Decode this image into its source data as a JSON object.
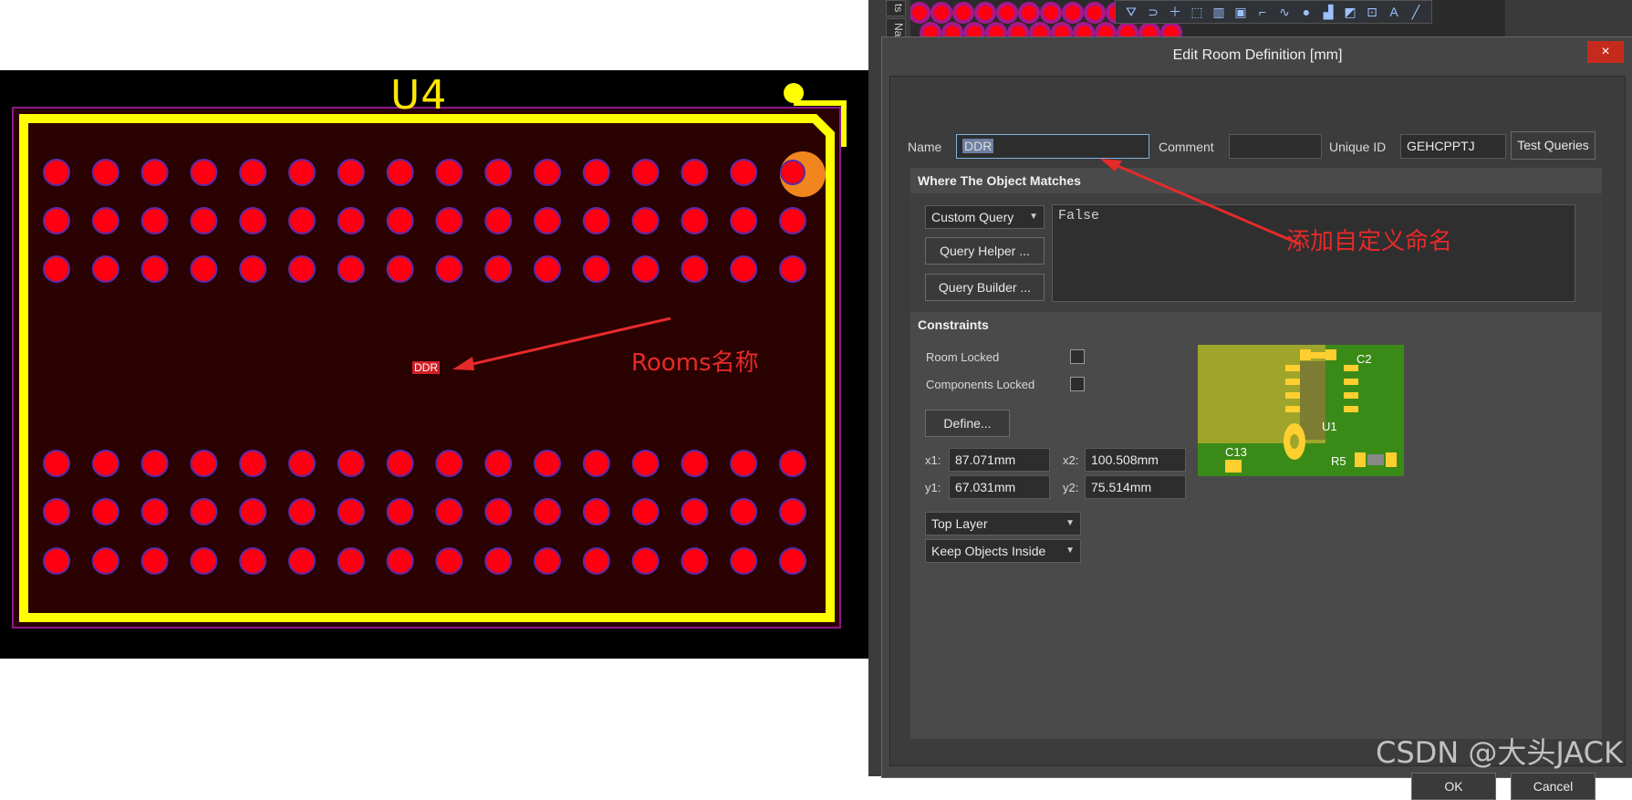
{
  "pcb": {
    "component_designator": "U4",
    "room_label": "DDR",
    "annotation": "Rooms名称",
    "colors": {
      "board": "#2a0000",
      "pad": "#ff0012",
      "silk": "#ffff00",
      "outline": "#8b1a8b"
    }
  },
  "dialog": {
    "title": "Edit Room Definition [mm]",
    "close_label": "×",
    "name_label": "Name",
    "name_value": "DDR",
    "comment_label": "Comment",
    "comment_value": "",
    "unique_id_label": "Unique ID",
    "unique_id_value": "GEHCPPTJ",
    "test_queries_label": "Test Queries",
    "where_section_title": "Where The Object Matches",
    "query_type": "Custom Query",
    "query_helper_label": "Query Helper ...",
    "query_builder_label": "Query Builder ...",
    "query_text": "False",
    "constraints_title": "Constraints",
    "room_locked_label": "Room Locked",
    "components_locked_label": "Components Locked",
    "define_label": "Define...",
    "x1_label": "x1:",
    "x1_value": "87.071mm",
    "x2_label": "x2:",
    "x2_value": "100.508mm",
    "y1_label": "y1:",
    "y1_value": "67.031mm",
    "y2_label": "y2:",
    "y2_value": "75.514mm",
    "layer": "Top Layer",
    "keep_mode": "Keep Objects Inside",
    "ok_label": "OK",
    "cancel_label": "Cancel"
  },
  "preview": {
    "labels": [
      "C2",
      "U1",
      "C13",
      "R5"
    ]
  },
  "annotation_custom": "添加自定义命名",
  "side_tabs": [
    "ts",
    "Na"
  ],
  "watermark": "CSDN @大头JACK"
}
